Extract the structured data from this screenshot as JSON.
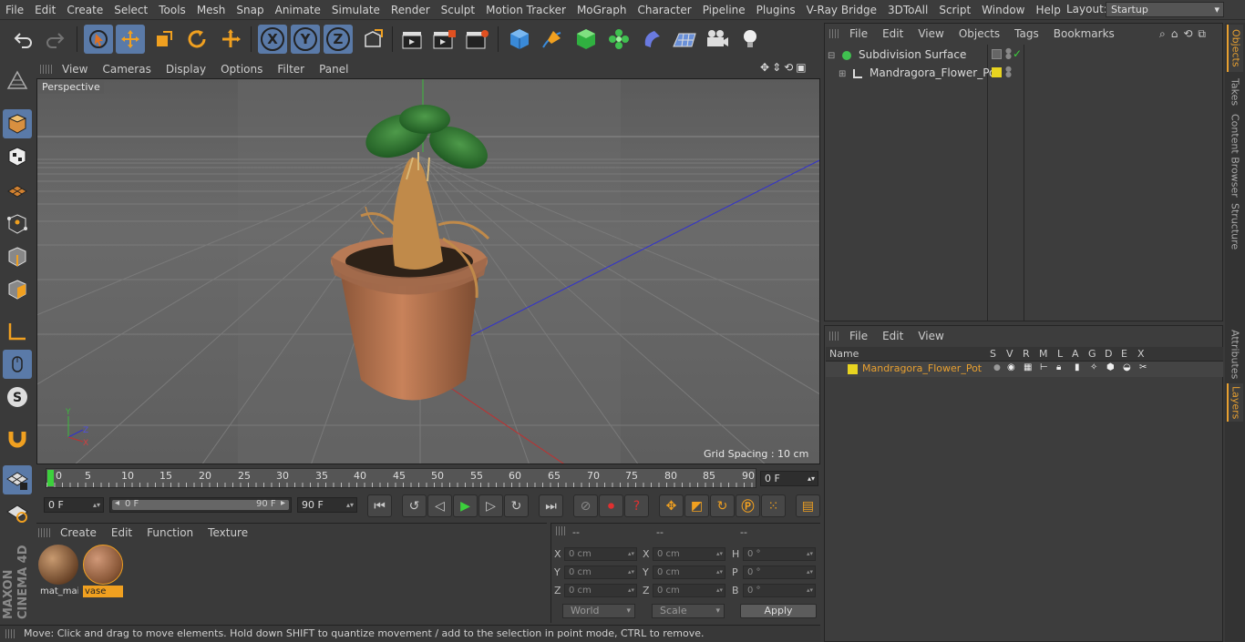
{
  "menubar": {
    "items": [
      "File",
      "Edit",
      "Create",
      "Select",
      "Tools",
      "Mesh",
      "Snap",
      "Animate",
      "Simulate",
      "Render",
      "Sculpt",
      "Motion Tracker",
      "MoGraph",
      "Character",
      "Pipeline",
      "Plugins",
      "V-Ray Bridge",
      "3DToAll",
      "Script",
      "Window",
      "Help"
    ],
    "layout_label": "Layout:",
    "layout_value": "Startup"
  },
  "toolbar": {
    "axis_x": "X",
    "axis_y": "Y",
    "axis_z": "Z"
  },
  "viewport": {
    "menu": [
      "View",
      "Cameras",
      "Display",
      "Options",
      "Filter",
      "Panel"
    ],
    "camera_label": "Perspective",
    "grid_spacing": "Grid Spacing : 10 cm"
  },
  "timeline": {
    "ticks": [
      "0",
      "5",
      "10",
      "15",
      "20",
      "25",
      "30",
      "35",
      "40",
      "45",
      "50",
      "55",
      "60",
      "65",
      "70",
      "75",
      "80",
      "85",
      "90"
    ],
    "current_frame": "0 F",
    "start_field": "0 F",
    "range_start": "0 F",
    "range_end": "90 F",
    "end_field": "90 F"
  },
  "materials": {
    "menu": [
      "Create",
      "Edit",
      "Function",
      "Texture"
    ],
    "items": [
      {
        "label": "mat_mai",
        "selected": false
      },
      {
        "label": "vase",
        "selected": true
      }
    ]
  },
  "coordinates": {
    "header": [
      "--",
      "--",
      "--"
    ],
    "rows": [
      {
        "a_label": "X",
        "a_val": "0 cm",
        "b_label": "X",
        "b_val": "0 cm",
        "c_label": "H",
        "c_val": "0 °"
      },
      {
        "a_label": "Y",
        "a_val": "0 cm",
        "b_label": "Y",
        "b_val": "0 cm",
        "c_label": "P",
        "c_val": "0 °"
      },
      {
        "a_label": "Z",
        "a_val": "0 cm",
        "b_label": "Z",
        "b_val": "0 cm",
        "c_label": "B",
        "c_val": "0 °"
      }
    ],
    "space": "World",
    "mode": "Scale",
    "apply": "Apply"
  },
  "status": {
    "text": "Move: Click and drag to move elements. Hold down SHIFT to quantize movement / add to the selection in point mode, CTRL to remove."
  },
  "objects": {
    "menu": [
      "File",
      "Edit",
      "View",
      "Objects",
      "Tags",
      "Bookmarks"
    ],
    "items": [
      {
        "name": "Subdivision Surface"
      },
      {
        "name": "Mandragora_Flower_Pot"
      }
    ]
  },
  "layers": {
    "menu": [
      "File",
      "Edit",
      "View"
    ],
    "columns": [
      "Name",
      "S",
      "V",
      "R",
      "M",
      "L",
      "A",
      "G",
      "D",
      "E",
      "X"
    ],
    "items": [
      {
        "name": "Mandragora_Flower_Pot",
        "color": "#e8d420"
      }
    ]
  },
  "side_tabs": [
    "Objects",
    "Takes",
    "Content Browser",
    "Structure",
    "Attributes",
    "Layers"
  ],
  "colors": {
    "accent_orange": "#e8a030",
    "selection_blue": "#5a7aa8",
    "layer_yellow": "#e8d420"
  }
}
